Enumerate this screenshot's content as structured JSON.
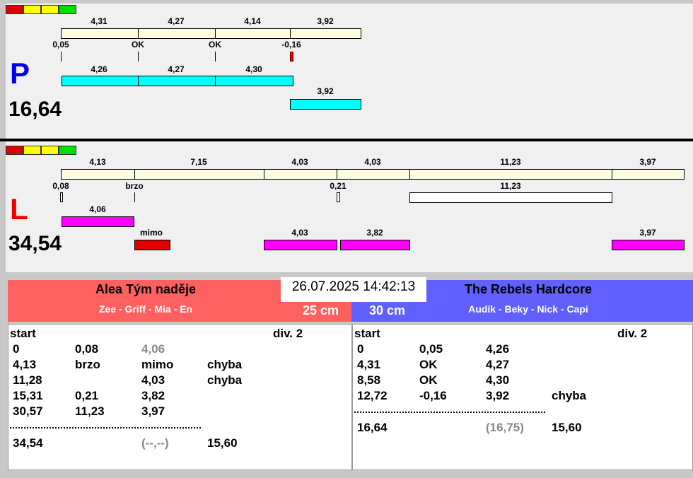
{
  "colors": {
    "red": "#e00000",
    "yellow": "#ffff00",
    "green": "#00e000",
    "cyan": "#00ffff",
    "magenta": "#ff00ff",
    "team_left": "#ff6060",
    "team_right": "#6060ff"
  },
  "p": {
    "letter": "P",
    "score": "16,64",
    "top": [
      "4,31",
      "4,27",
      "4,14",
      "3,92"
    ],
    "sub": [
      "0,05",
      "OK",
      "OK",
      "-0,16"
    ],
    "cyan": [
      "4,26",
      "4,27",
      "4,30"
    ],
    "cyan2": "3,92"
  },
  "l": {
    "letter": "L",
    "score": "34,54",
    "top": [
      "4,13",
      "7,15",
      "4,03",
      "4,03",
      "11,23",
      "3,97"
    ],
    "sub": [
      "0,08",
      "brzo",
      "0,21",
      "11,23"
    ],
    "mag1": "4,06",
    "miss": "mimo",
    "mag": [
      "4,03",
      "3,82",
      "3,97"
    ]
  },
  "datetime": "26.07.2025 14:42:13",
  "left_team": {
    "name": "Alea Tým naděje",
    "players": "Zee - Griff - Mia - En",
    "distance": "25 cm",
    "start": "start",
    "div": "div. 2",
    "rows": [
      [
        "0",
        "0,08",
        "4,06",
        ""
      ],
      [
        "4,13",
        "brzo",
        "mimo",
        "chyba"
      ],
      [
        "11,28",
        "",
        "4,03",
        "chyba"
      ],
      [
        "15,31",
        "0,21",
        "3,82",
        ""
      ],
      [
        "30,57",
        "11,23",
        "3,97",
        ""
      ]
    ],
    "total": [
      "34,54",
      "(--,--)",
      "15,60"
    ]
  },
  "right_team": {
    "name": "The Rebels Hardcore",
    "players": "Audík - Beky - Nick - Capi",
    "distance": "30 cm",
    "start": "start",
    "div": "div. 2",
    "rows": [
      [
        "0",
        "0,05",
        "4,26",
        ""
      ],
      [
        "4,31",
        "OK",
        "4,27",
        ""
      ],
      [
        "8,58",
        "OK",
        "4,30",
        ""
      ],
      [
        "12,72",
        "-0,16",
        "3,92",
        "chyba"
      ]
    ],
    "total": [
      "16,64",
      "(16,75)",
      "15,60"
    ]
  }
}
